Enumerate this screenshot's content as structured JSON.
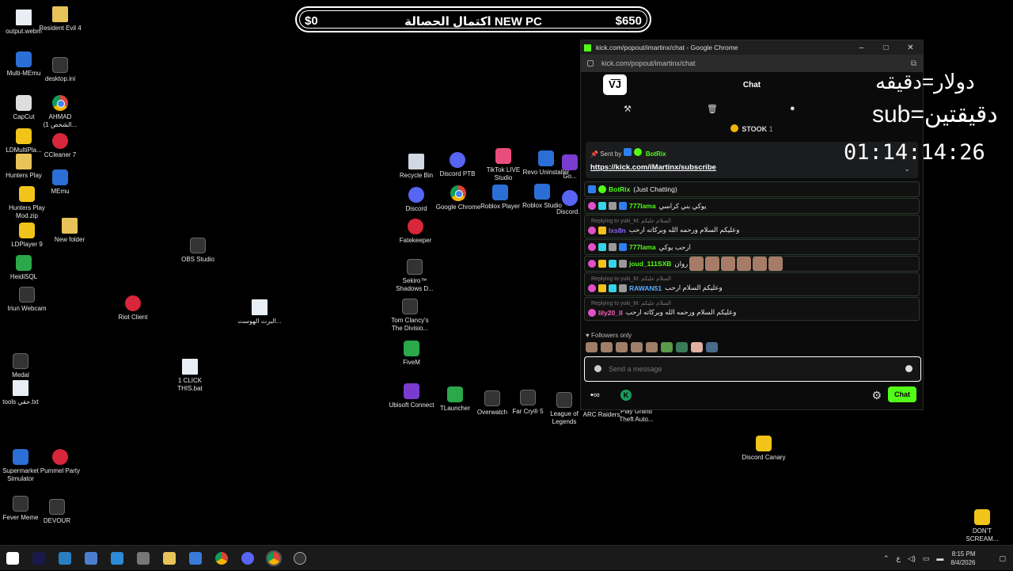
{
  "goal": {
    "start": "$0",
    "title": "اكتمال الحصالة NEW PC",
    "end": "$650"
  },
  "desktop_icons": [
    {
      "label": "output.webm",
      "kind": "file"
    },
    {
      "label": "Resident Evil 4",
      "kind": "folder"
    },
    {
      "label": "Multi-MEmu",
      "kind": "blue"
    },
    {
      "label": "desktop.ini",
      "kind": "dark"
    },
    {
      "label": "CapCut",
      "kind": "white"
    },
    {
      "label": "AHMAD (الشخص 1...",
      "kind": "chrome"
    },
    {
      "label": "LDMultiPla...",
      "kind": "yellow"
    },
    {
      "label": "CCleaner 7",
      "kind": "red"
    },
    {
      "label": "Hunters Play",
      "kind": "folder"
    },
    {
      "label": "MEmu",
      "kind": "blue"
    },
    {
      "label": "Hunters Play Mod.zip",
      "kind": "yellow"
    },
    {
      "label": "LDPlayer 9",
      "kind": "yellow"
    },
    {
      "label": "New folder",
      "kind": "folder"
    },
    {
      "label": "HeidiSQL",
      "kind": "green"
    },
    {
      "label": "Iriun Webcam",
      "kind": "dark"
    },
    {
      "label": "Medal",
      "kind": "dark"
    },
    {
      "label": "tools حقي.txt",
      "kind": "file"
    },
    {
      "label": "Supermarket Simulator",
      "kind": "blue"
    },
    {
      "label": "Pummel Party",
      "kind": "red"
    },
    {
      "label": "Fever Meme",
      "kind": "dark"
    },
    {
      "label": "DEVOUR",
      "kind": "dark"
    },
    {
      "label": "OBS Studio",
      "kind": "dark"
    },
    {
      "label": "Riot Client",
      "kind": "red"
    },
    {
      "label": "البرت الهوست...",
      "kind": "file"
    },
    {
      "label": "1 CLICK THIS.bat",
      "kind": "file"
    },
    {
      "label": "Recycle Bin",
      "kind": "recycle"
    },
    {
      "label": "Discord PTB",
      "kind": "discord"
    },
    {
      "label": "TikTok LIVE Studio",
      "kind": "pink"
    },
    {
      "label": "Revo Uninstaller",
      "kind": "blue"
    },
    {
      "label": "Go...",
      "kind": "purple"
    },
    {
      "label": "Discord",
      "kind": "discord"
    },
    {
      "label": "Google Chrome",
      "kind": "chrome"
    },
    {
      "label": "Roblox Player",
      "kind": "blue"
    },
    {
      "label": "Roblox Studio",
      "kind": "blue"
    },
    {
      "label": "Discord...",
      "kind": "discord"
    },
    {
      "label": "Fatekeeper",
      "kind": "red"
    },
    {
      "label": "Sekiro™ Shadows D...",
      "kind": "dark"
    },
    {
      "label": "Tom Clancy's The Divisio...",
      "kind": "dark"
    },
    {
      "label": "FiveM",
      "kind": "green"
    },
    {
      "label": "Ubisoft Connect",
      "kind": "purple"
    },
    {
      "label": "TLauncher",
      "kind": "green"
    },
    {
      "label": "Overwatch",
      "kind": "dark"
    },
    {
      "label": "Far Cry® 5",
      "kind": "dark"
    },
    {
      "label": "League of Legends",
      "kind": "dark"
    },
    {
      "label": "ARC Raiders",
      "kind": "dark"
    },
    {
      "label": "Play Grand Theft Auto...",
      "kind": "dark"
    },
    {
      "label": "Discord Canary",
      "kind": "yellow"
    },
    {
      "label": "DON'T SCREAM...",
      "kind": "yellow"
    }
  ],
  "window": {
    "title": "kick.com/popout/imartinx/chat - Google Chrome",
    "url": "kick.com/popout/imartinx/chat",
    "chat_title": "Chat",
    "logo": "V͞J",
    "stook_label": "STOOK",
    "stook_count": "1",
    "pinned": {
      "sent_by": "Sent by",
      "sender": "BotRix",
      "link": "https://kick.com/iMartinx/subscribe"
    },
    "messages": [
      {
        "user": "BotRix",
        "color": "#53fc18",
        "text": "(Just Chatting)",
        "reply": ""
      },
      {
        "user": "777lama",
        "color": "#53fc18",
        "text": "يوكي بني كراسي",
        "reply": ""
      },
      {
        "user": "lxs8n",
        "color": "#8a63ff",
        "text": "وعليكم السلام ورحمه الله وبركاته ارحب",
        "reply": "Replying to yuki_M: السلام عليكم"
      },
      {
        "user": "777lama",
        "color": "#53fc18",
        "text": "ارحب يوكي",
        "reply": ""
      },
      {
        "user": "joud_111SXB",
        "color": "#53fc18",
        "text": "روان",
        "reply": ""
      },
      {
        "user": "RAWAN51",
        "color": "#5ab0ff",
        "text": "وعليكم السلام ارحب",
        "reply": "Replying to yuki_M: السلام عليكم"
      },
      {
        "user": "lily20_ll",
        "color": "#ff5fc0",
        "text": "وعليكم السلام ورحمه الله وبركاته ارحب",
        "reply": "Replying to yuki_M: السلام عليكم"
      }
    ],
    "followers_only": "Followers only",
    "input_placeholder": "Send a message",
    "chat_button": "Chat"
  },
  "overlay": {
    "line1": "دولار=دقيقه",
    "line2": "sub=دقيقتين",
    "timer": "01:14:14:26"
  },
  "taskbar": {
    "time": "8:15 PM",
    "date": "8/4/2026",
    "lang": "ع"
  },
  "colors": {
    "kick_green": "#53fc18",
    "chat_bg": "#0b0b0c"
  }
}
